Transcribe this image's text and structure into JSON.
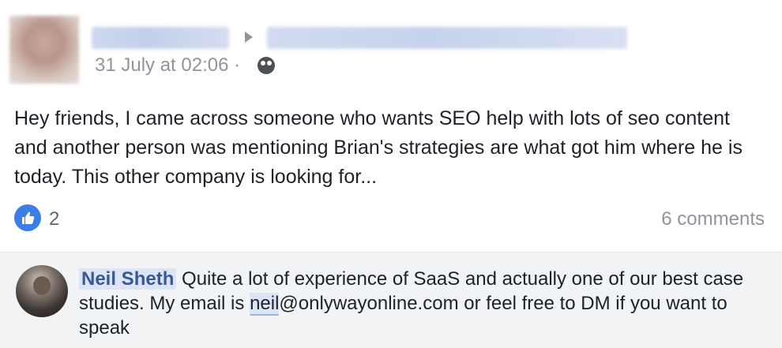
{
  "post": {
    "timestamp": "31 July at 02:06 ·",
    "body": "Hey friends, I came across someone who wants SEO help with lots of seo content and another person was mentioning Brian's strategies are what got him where he is today. This other company is looking for...",
    "like_count": "2",
    "comments_count": "6 comments",
    "icons": {
      "like": "like-icon",
      "audience": "globe-icon",
      "share_arrow": "arrow-icon"
    }
  },
  "comment": {
    "author": "Neil Sheth",
    "text_before_email": " Quite a lot of experience of SaaS and actually one of our best case studies. My email is ",
    "email_user": "neil",
    "text_after_email": "@onlywayonline.com or feel free to DM if you want to speak"
  },
  "colors": {
    "link": "#385898",
    "like_blue": "#3b7ee8",
    "muted_text": "#90949c",
    "comment_bg": "#f2f3f5"
  }
}
